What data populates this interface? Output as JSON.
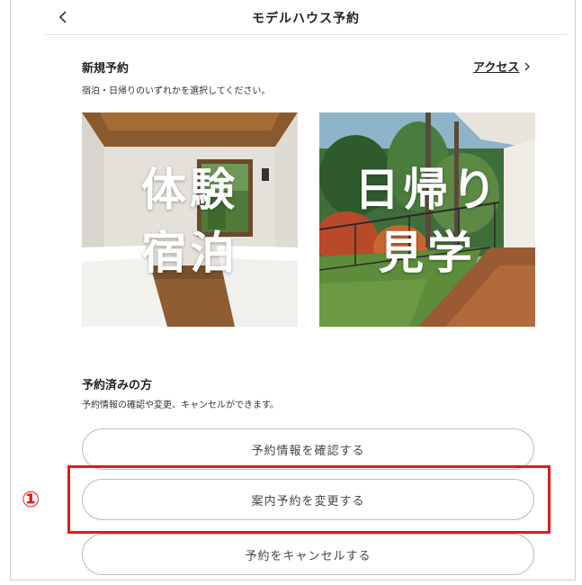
{
  "header": {
    "title": "モデルハウス予約"
  },
  "new_reservation": {
    "title": "新規予約",
    "description": "宿泊・日帰りのいずれかを選択してください。",
    "access_link": "アクセス",
    "cards": [
      {
        "line1": "体験",
        "line2": "宿泊"
      },
      {
        "line1": "日帰り",
        "line2": "見学"
      }
    ]
  },
  "existing": {
    "title": "予約済みの方",
    "description": "予約情報の確認や変更、キャンセルができます。",
    "buttons": {
      "confirm": "予約情報を確認する",
      "change": "案内予約を変更する",
      "cancel": "予約をキャンセルする"
    }
  },
  "annotation": {
    "step": "①",
    "color": "#e61919"
  },
  "icons": [
    "chevron-left-icon",
    "chevron-right-icon"
  ]
}
